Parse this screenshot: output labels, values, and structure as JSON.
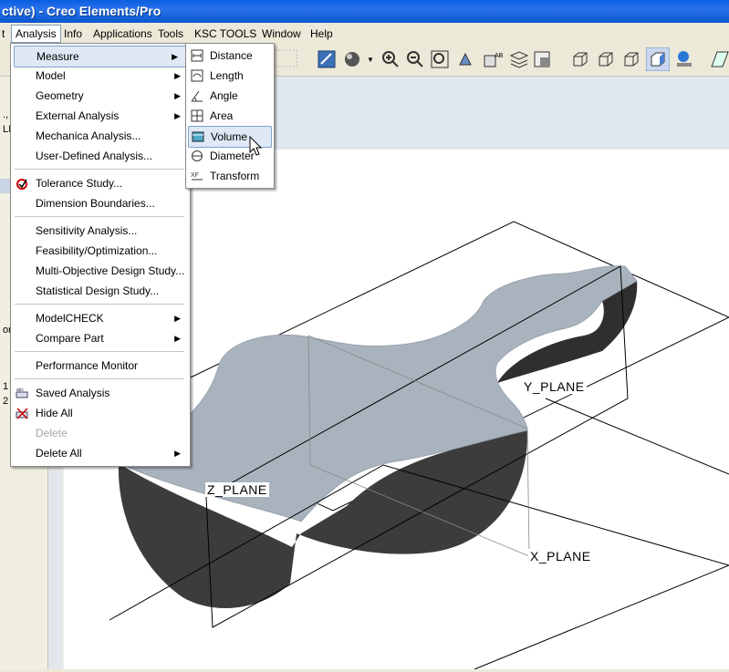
{
  "window": {
    "title": "ctive) - Creo Elements/Pro"
  },
  "menubar": {
    "items": [
      "t",
      "Analysis",
      "Info",
      "Applications",
      "Tools",
      "KSC TOOLS",
      "Window",
      "Help"
    ]
  },
  "left_panel": {
    "texts": [
      "., tc",
      "LI",
      "om",
      "1",
      "2"
    ]
  },
  "analysis_menu": {
    "items": [
      {
        "label": "Measure",
        "submenu": true,
        "highlighted": true
      },
      {
        "label": "Model",
        "submenu": true
      },
      {
        "label": "Geometry",
        "submenu": true
      },
      {
        "label": "External Analysis",
        "submenu": true
      },
      {
        "label": "Mechanica Analysis..."
      },
      {
        "label": "User-Defined Analysis..."
      },
      {
        "label": "Tolerance Study...",
        "icon": "tolerance-icon"
      },
      {
        "label": "Dimension Boundaries..."
      },
      {
        "label": "Sensitivity Analysis..."
      },
      {
        "label": "Feasibility/Optimization..."
      },
      {
        "label": "Multi-Objective Design Study..."
      },
      {
        "label": "Statistical Design Study..."
      },
      {
        "label": "ModelCHECK",
        "submenu": true
      },
      {
        "label": "Compare Part",
        "submenu": true
      },
      {
        "label": "Performance Monitor"
      },
      {
        "label": "Saved Analysis",
        "icon": "saved-analysis-icon"
      },
      {
        "label": "Hide All",
        "icon": "hide-all-icon"
      },
      {
        "label": "Delete",
        "disabled": true
      },
      {
        "label": "Delete All",
        "submenu": true
      }
    ]
  },
  "measure_submenu": {
    "items": [
      {
        "label": "Distance",
        "icon": "distance-icon"
      },
      {
        "label": "Length",
        "icon": "length-icon"
      },
      {
        "label": "Angle",
        "icon": "angle-icon"
      },
      {
        "label": "Area",
        "icon": "area-icon"
      },
      {
        "label": "Volume",
        "icon": "volume-icon",
        "highlighted": true
      },
      {
        "label": "Diameter",
        "icon": "diameter-icon"
      },
      {
        "label": "Transform",
        "icon": "transform-icon"
      }
    ]
  },
  "datum_planes": {
    "y": "Y_PLANE",
    "z": "Z_PLANE",
    "x": "X_PLANE"
  },
  "colors": {
    "title_blue": "#0a5ee0",
    "part_top": "#aab3bc",
    "part_side": "#3a3a3a",
    "menu_highlight": "#dfe9f5"
  }
}
